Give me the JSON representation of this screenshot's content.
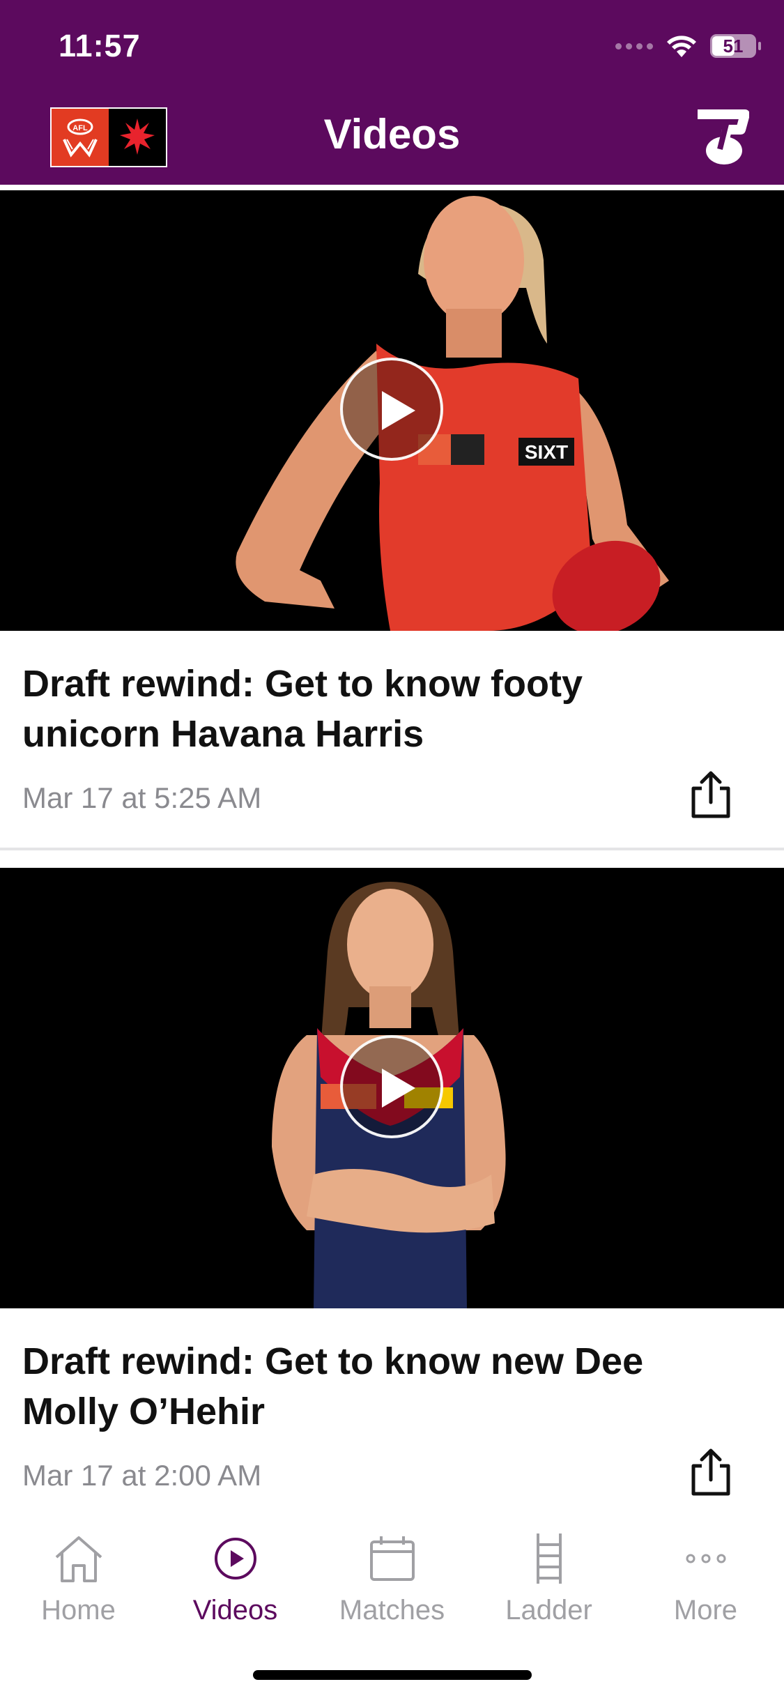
{
  "status_bar": {
    "time": "11:57",
    "battery": "51"
  },
  "nav": {
    "title": "Videos",
    "left_logo": "afl-women-logo",
    "right_logo": "telstra-logo"
  },
  "videos": [
    {
      "title": "Draft rewind: Get to know footy unicorn Havana Harris",
      "date": "Mar 17 at 5:25 AM",
      "thumbnail_desc": "player in red guernsey holding football",
      "icons": [
        "play-icon",
        "share-icon"
      ]
    },
    {
      "title": "Draft rewind: Get to know new Dee Molly O’Hehir",
      "date": "Mar 17 at 2:00 AM",
      "thumbnail_desc": "player in navy and red guernsey with crossed arms",
      "icons": [
        "play-icon",
        "share-icon"
      ]
    }
  ],
  "tabbar": {
    "tabs": [
      {
        "label": "Home",
        "icon": "home-icon",
        "active": false
      },
      {
        "label": "Videos",
        "icon": "play-circle-icon",
        "active": true
      },
      {
        "label": "Matches",
        "icon": "calendar-icon",
        "active": false
      },
      {
        "label": "Ladder",
        "icon": "ladder-icon",
        "active": false
      },
      {
        "label": "More",
        "icon": "more-icon",
        "active": false
      }
    ]
  },
  "colors": {
    "brand_purple": "#5c0a5e",
    "afl_red": "#e23b22",
    "inactive_gray": "#a0a0a4"
  }
}
